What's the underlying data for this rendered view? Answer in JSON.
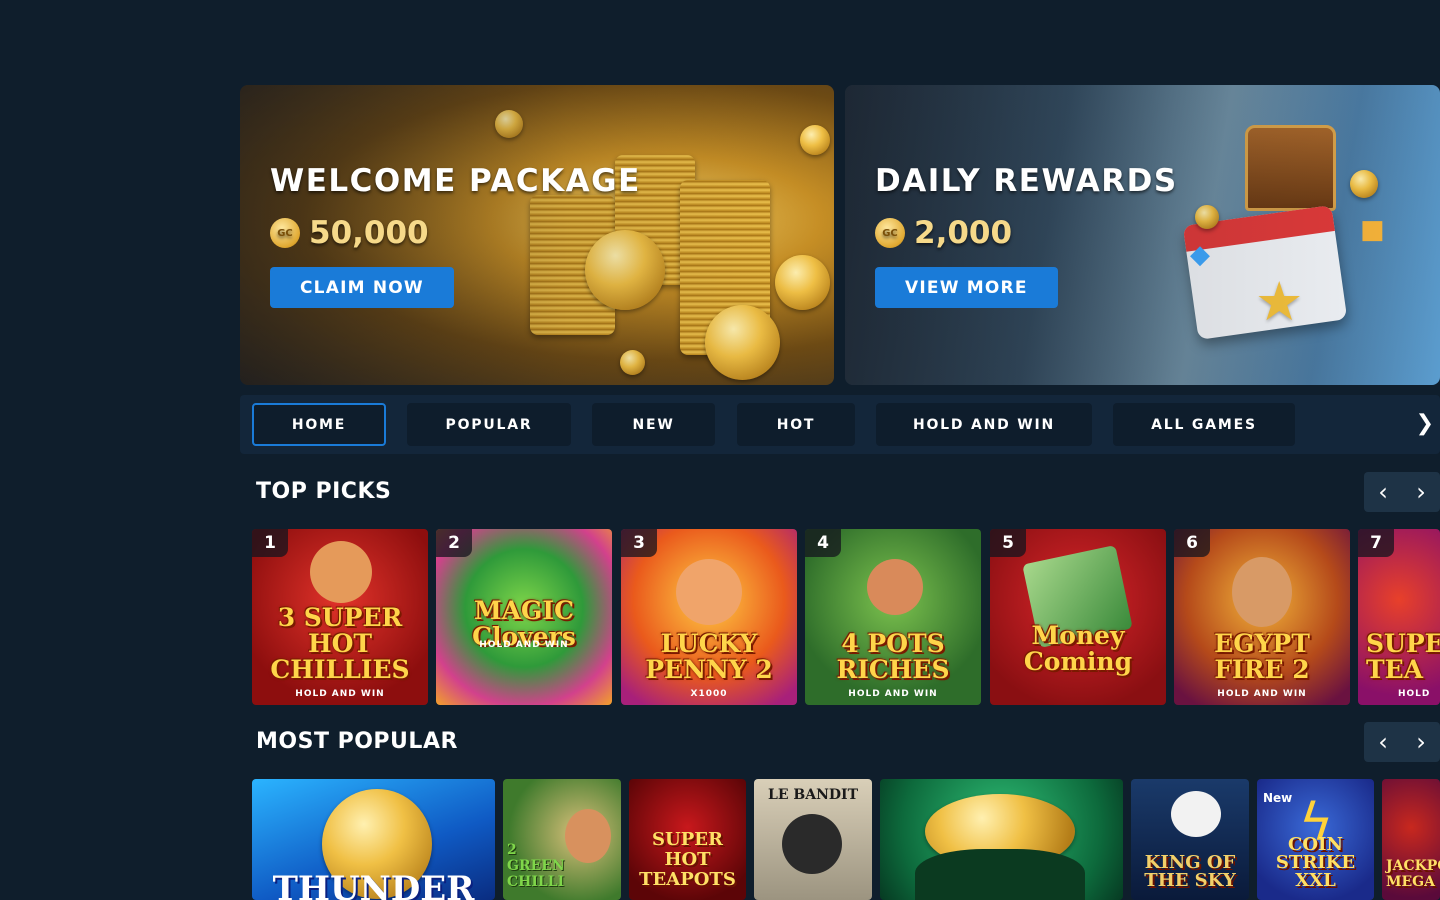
{
  "banners": [
    {
      "title": "WELCOME PACKAGE",
      "currency_icon": "GC",
      "amount": "50,000",
      "button": "CLAIM NOW"
    },
    {
      "title": "DAILY REWARDS",
      "currency_icon": "GC",
      "amount": "2,000",
      "button": "VIEW MORE"
    }
  ],
  "tabs": [
    "HOME",
    "POPULAR",
    "NEW",
    "HOT",
    "HOLD AND WIN",
    "ALL GAMES"
  ],
  "active_tab": "HOME",
  "top_picks": {
    "title": "TOP PICKS",
    "games": [
      {
        "rank": "1",
        "name": "3 SUPER HOT CHILLIES",
        "sub": "HOLD AND WIN"
      },
      {
        "rank": "2",
        "name": "MAGIC Clovers",
        "sub": "HOLD AND WIN"
      },
      {
        "rank": "3",
        "name": "LUCKY PENNY 2",
        "sub": "X1000"
      },
      {
        "rank": "4",
        "name": "4 POTS RICHES",
        "sub": "HOLD AND WIN"
      },
      {
        "rank": "5",
        "name": "Money Coming",
        "sub": ""
      },
      {
        "rank": "6",
        "name": "EGYPT FIRE 2",
        "sub": "HOLD AND WIN"
      },
      {
        "rank": "7",
        "name": "SUPER HOT TEA",
        "sub": "HOLD"
      }
    ]
  },
  "most_popular": {
    "title": "MOST POPULAR",
    "games": [
      {
        "name": "THUNDER",
        "badge": ""
      },
      {
        "name": "2 GREEN CHILLI",
        "badge": ""
      },
      {
        "name": "SUPER HOT TEAPOTS",
        "badge": ""
      },
      {
        "name": "LE BANDIT",
        "badge": ""
      },
      {
        "name": "",
        "badge": ""
      },
      {
        "name": "KING OF THE SKY",
        "badge": ""
      },
      {
        "name": "COIN STRIKE XXL",
        "badge": "New"
      },
      {
        "name": "JACKPOT MEGA",
        "badge": ""
      }
    ]
  },
  "icons": {
    "prev": "chevron-left-icon",
    "next": "chevron-right-icon"
  },
  "colors": {
    "background": "#0f1e2c",
    "accent": "#1a7bd8",
    "gold": "#f6d98a"
  }
}
